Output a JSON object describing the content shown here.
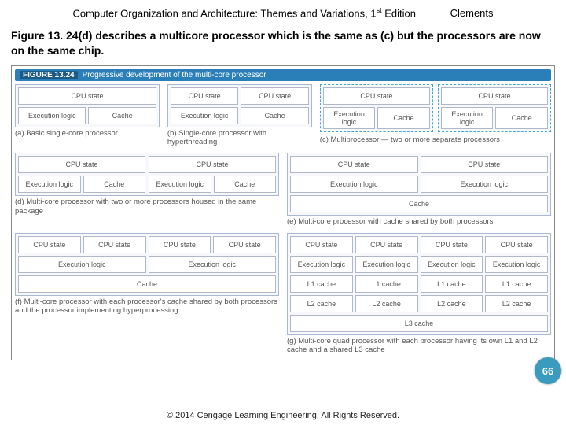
{
  "header": {
    "title_a": "Computer Organization and Architecture: Themes and Variations, 1",
    "title_sup": "st",
    "title_b": " Edition",
    "author": "Clements"
  },
  "description": "Figure 13. 24(d) describes a multicore processor which is the same as (c) but the processors are now on the same chip.",
  "figure": {
    "num": "FIGURE 13.24",
    "title": "Progressive development of the multi-core processor",
    "labels": {
      "cpu": "CPU state",
      "exec": "Execution logic",
      "cache": "Cache",
      "l1": "L1 cache",
      "l2": "L2 cache",
      "l3": "L3 cache"
    },
    "captions": {
      "a": "(a) Basic single-core processor",
      "b": "(b) Single-core processor with hyperthreading",
      "c": "(c) Multiprocessor — two or more separate processors",
      "d": "(d) Multi-core processor with two or more processors housed in the same package",
      "e": "(e) Multi-core processor with cache shared by both processors",
      "f": "(f) Multi-core processor with each processor's cache shared by both processors and the processor implementing hyperprocessing",
      "g": "(g) Multi-core quad processor with each processor having its own L1 and L2 cache and a shared L3 cache"
    }
  },
  "page": "66",
  "copyright": "© 2014 Cengage Learning Engineering. All Rights Reserved."
}
